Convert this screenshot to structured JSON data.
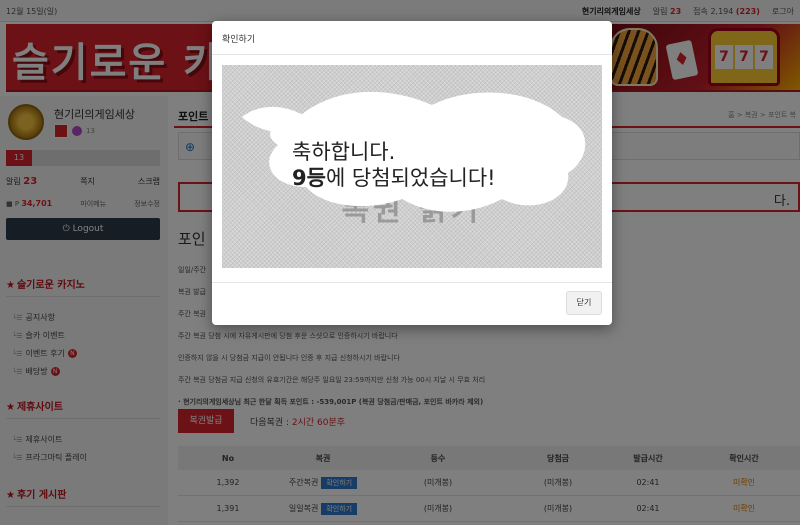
{
  "topbar": {
    "date": "12월 15일(일)",
    "site_name": "현기리의게임세상",
    "alarm_label": "알림",
    "alarm_count": "23",
    "visit_label": "접속",
    "visit_total": "2,194",
    "visit_today": "(223)",
    "logout_label": "로그아"
  },
  "banner": {
    "title": "슬기로운 카",
    "slot_symbols": [
      "7",
      "7",
      "7"
    ],
    "card_symbol": "♦"
  },
  "profile": {
    "name": "현기리의게임세상",
    "level_small": "13",
    "level": "13",
    "alarm_label": "알림",
    "alarm_count": "23",
    "note_label": "쪽지",
    "scrap_label": "스크랩",
    "point_label": "P",
    "point_value": "34,701",
    "mypage_label": "마이메뉴",
    "edit_label": "정보수정",
    "logout_label": "Logout"
  },
  "sidebar": {
    "sections": [
      {
        "title": "슬기로운 카지노",
        "items": [
          {
            "label": "공지사항",
            "new": false
          },
          {
            "label": "슬카 이벤트",
            "new": false
          },
          {
            "label": "이벤트 후기",
            "new": true
          },
          {
            "label": "배당방",
            "new": true
          }
        ]
      },
      {
        "title": "제휴사이트",
        "items": [
          {
            "label": "제휴사이트",
            "new": false
          },
          {
            "label": "프라그마틱 플레이",
            "new": false
          }
        ]
      },
      {
        "title": "후기 게시판",
        "items": []
      }
    ],
    "new_badge": "N"
  },
  "main": {
    "page_title": "포인트",
    "breadcrumb": "홈 > 복권 > 포인트 복",
    "banner_text": "다.",
    "subtitle": "포인",
    "notes": [
      "일일/주간",
      "복권 발급",
      "주간 복권",
      "주간 복권 당첨 시에 자유게시판에 당첨 후운 스샷으로 인증하시기 바랍니다",
      "인증하지 않을 시 당첨금 지급이 안됩니다 인증 후 지급 신청하시기 바랍니다",
      "주간 복권 당첨금 지급 신청의 유효기간은 해당주 일요일 23:59까지만 신청 가능 00시 지날 시 무효 처리",
      "· 현기리의게임세상님 최근 한달 획득 포인트 : -539,001P (복권 당첨금/판매금, 포인트 바카라 제외)"
    ],
    "issue_button": "복권발급",
    "next_label": "다음복권 :",
    "next_time": "2시간 60분후",
    "table": {
      "headers": [
        "No",
        "복권",
        "등수",
        "당첨금",
        "발급시간",
        "확인시간"
      ],
      "rows": [
        {
          "no": "1,392",
          "type": "주간복권",
          "action": "확인하기",
          "rank": "(미개봉)",
          "prize": "(미개봉)",
          "issued": "02:41",
          "checked": "미확인"
        },
        {
          "no": "1,391",
          "type": "일일복권",
          "action": "확인하기",
          "rank": "(미개봉)",
          "prize": "(미개봉)",
          "issued": "02:41",
          "checked": "미확인"
        }
      ]
    }
  },
  "modal": {
    "title": "확인하기",
    "scratch_bg_text": "복권 긁기",
    "result_line1": "축하합니다.",
    "result_rank": "9등",
    "result_line2_rest": "에 당첨되었습니다!",
    "close_label": "닫기"
  }
}
